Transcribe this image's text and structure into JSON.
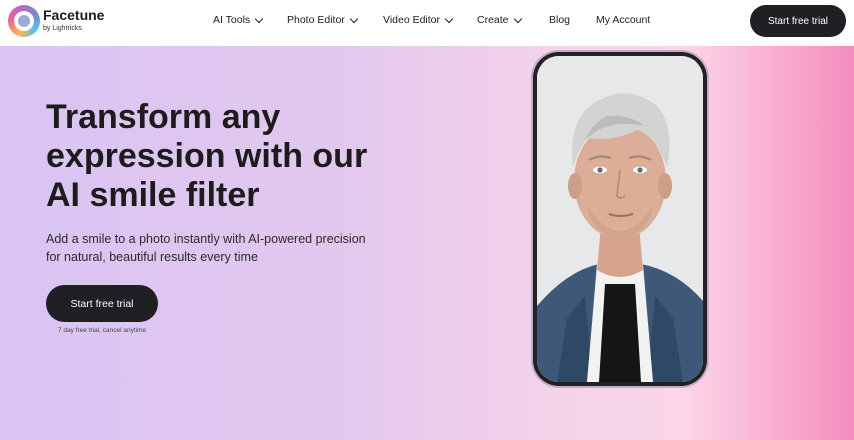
{
  "nav": {
    "brand": "Facetune",
    "brand_sub": "by Lightricks",
    "items": [
      {
        "label": "AI Tools",
        "dropdown": true
      },
      {
        "label": "Photo Editor",
        "dropdown": true
      },
      {
        "label": "Video Editor",
        "dropdown": true
      },
      {
        "label": "Create",
        "dropdown": true
      },
      {
        "label": "Blog",
        "dropdown": false
      },
      {
        "label": "My Account",
        "dropdown": false
      }
    ],
    "cta": "Start free trial"
  },
  "hero": {
    "headline": "Transform any expression with our AI smile filter",
    "subtitle": "Add a smile to a photo instantly with AI-powered precision for natural, beautiful results every time",
    "cta": "Start free trial",
    "fine_print": "7 day free trial, cancel anytime"
  },
  "colors": {
    "button_dark": "#1f1f24",
    "gradient_start": "#d9c4f4",
    "gradient_end": "#f48cbd"
  }
}
